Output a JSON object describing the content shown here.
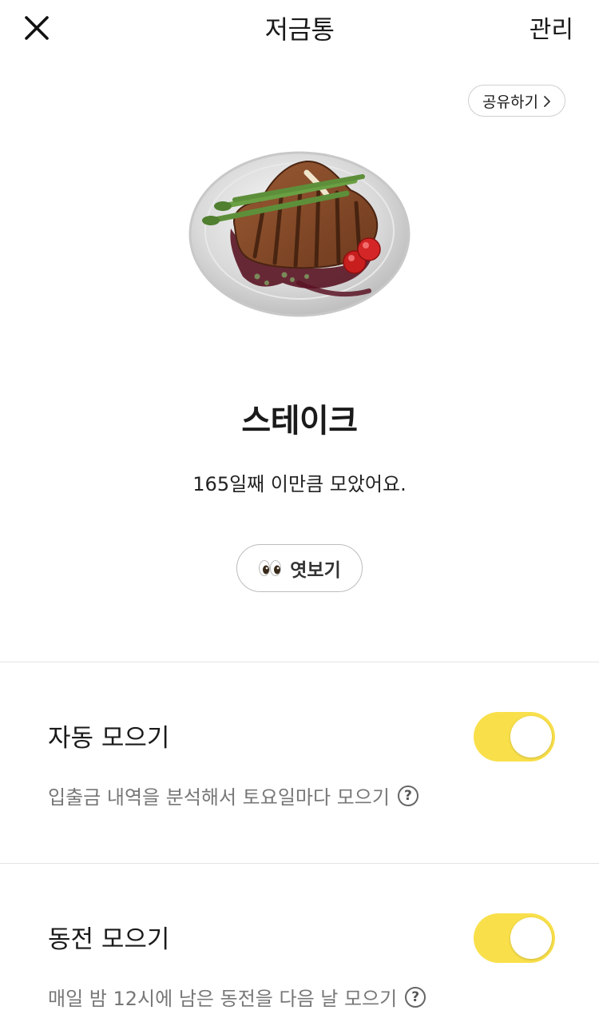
{
  "header": {
    "title": "저금통",
    "manage_label": "관리"
  },
  "share": {
    "label": "공유하기"
  },
  "piggybank": {
    "item_name": "스테이크",
    "saved_text": "165일째 이만큼 모았어요."
  },
  "peek": {
    "icon": "eyes-emoji",
    "label": "엿보기"
  },
  "settings": [
    {
      "title": "자동 모으기",
      "description": "입출금 내역을 분석해서 토요일마다 모으기",
      "enabled": true
    },
    {
      "title": "동전 모으기",
      "description": "매일 밤 12시에 남은 동전을 다음 날 모으기",
      "enabled": true
    }
  ],
  "colors": {
    "toggle_on": "#f9e04b",
    "divider": "#e3e3e3"
  }
}
